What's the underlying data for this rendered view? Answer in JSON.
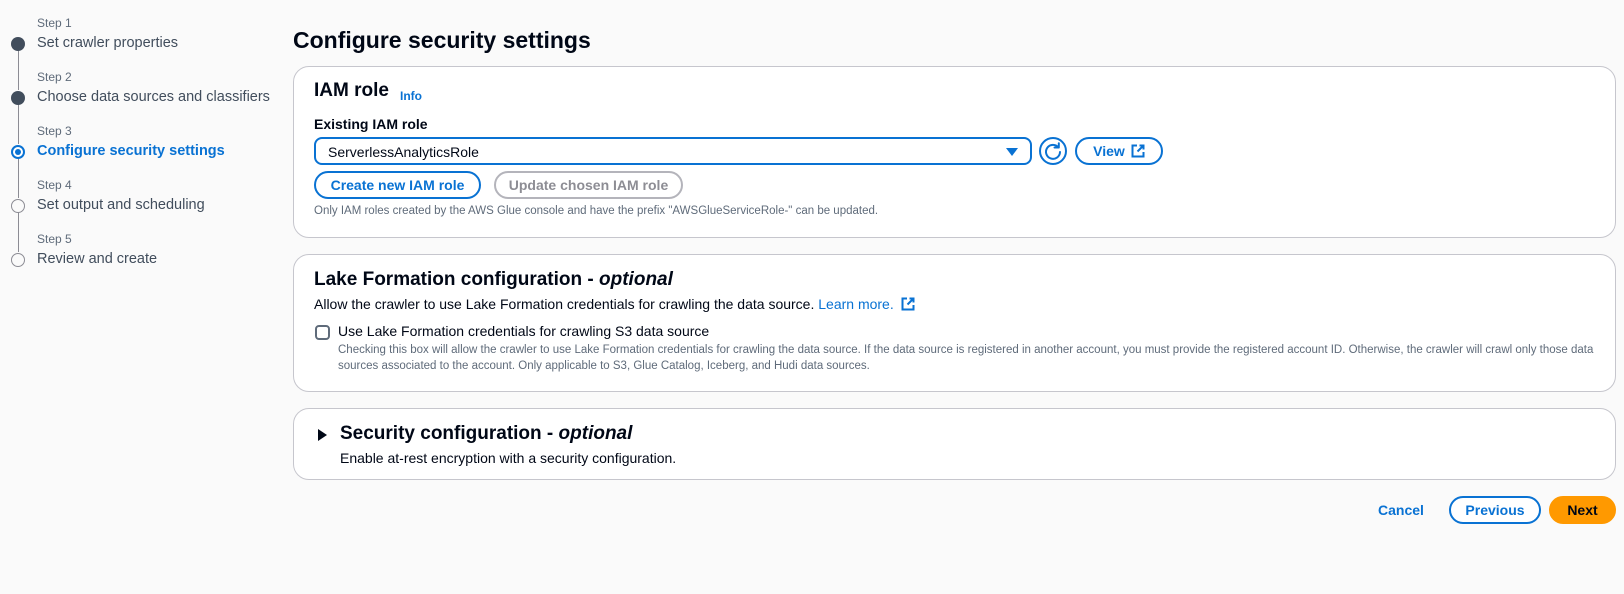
{
  "steps": [
    {
      "num": "Step 1",
      "title": "Set crawler properties",
      "state": "done"
    },
    {
      "num": "Step 2",
      "title": "Choose data sources and classifiers",
      "state": "done"
    },
    {
      "num": "Step 3",
      "title": "Configure security settings",
      "state": "current"
    },
    {
      "num": "Step 4",
      "title": "Set output and scheduling",
      "state": "pending"
    },
    {
      "num": "Step 5",
      "title": "Review and create",
      "state": "pending"
    }
  ],
  "page_title": "Configure security settings",
  "iam": {
    "heading": "IAM role",
    "info": "Info",
    "label": "Existing IAM role",
    "selected_role": "ServerlessAnalyticsRole",
    "view_label": "View",
    "create_label": "Create new IAM role",
    "update_label": "Update chosen IAM role",
    "hint": "Only IAM roles created by the AWS Glue console and have the prefix \"AWSGlueServiceRole-\" can be updated."
  },
  "lake": {
    "heading": "Lake Formation configuration -",
    "heading_opt": "optional",
    "description": "Allow the crawler to use Lake Formation credentials for crawling the data source.",
    "learn_more": "Learn more.",
    "checkbox_label": "Use Lake Formation credentials for crawling S3 data source",
    "checkbox_checked": false,
    "checkbox_desc": "Checking this box will allow the crawler to use Lake Formation credentials for crawling the data source. If the data source is registered in another account, you must provide the registered account ID. Otherwise, the crawler will crawl only those data sources associated to the account. Only applicable to S3, Glue Catalog, Iceberg, and Hudi data sources."
  },
  "security": {
    "heading": "Security configuration -",
    "heading_opt": "optional",
    "description": "Enable at-rest encryption with a security configuration.",
    "expanded": false
  },
  "footer": {
    "cancel": "Cancel",
    "previous": "Previous",
    "next": "Next"
  },
  "colors": {
    "accent": "#0972d3",
    "primary_button": "#ff9900",
    "text": "#000716"
  }
}
